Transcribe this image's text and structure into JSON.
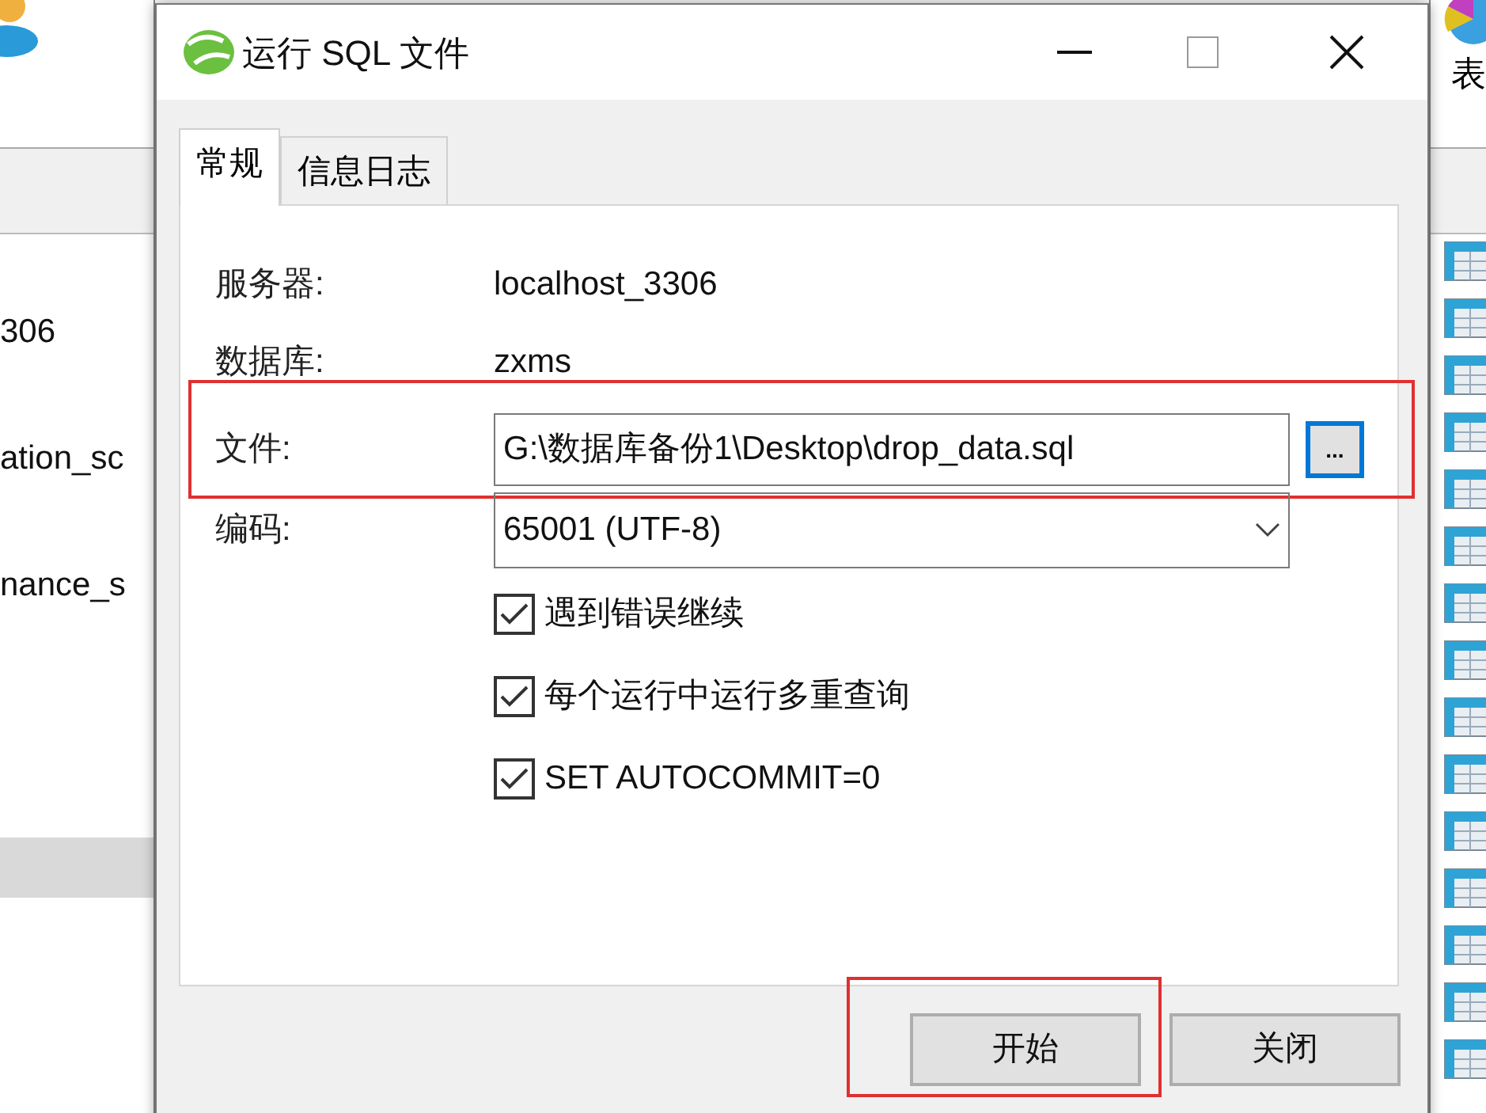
{
  "background": {
    "right_label": "表",
    "list_items": [
      {
        "label": "306",
        "selected": false
      },
      {
        "label": "ation_sc",
        "selected": false
      },
      {
        "label": "nance_s",
        "selected": false
      },
      {
        "selected": true
      }
    ]
  },
  "dialog": {
    "title": "运行 SQL 文件",
    "tabs": [
      {
        "label": "常规",
        "selected": true
      },
      {
        "label": "信息日志",
        "selected": false
      }
    ],
    "fields": [
      {
        "kind": "text",
        "label": "服务器:",
        "value": "localhost_3306"
      },
      {
        "kind": "text",
        "label": "数据库:",
        "value": "zxms"
      },
      {
        "kind": "file",
        "label": "文件:",
        "value": "G:\\数据库备份1\\Desktop\\drop_data.sql",
        "button": "...",
        "highlighted": true
      },
      {
        "kind": "select",
        "label": "编码:",
        "value": "65001 (UTF-8)"
      }
    ],
    "options": [
      {
        "label": "遇到错误继续",
        "checked": true
      },
      {
        "label": "每个运行中运行多重查询",
        "checked": true
      },
      {
        "label": "SET AUTOCOMMIT=0",
        "checked": true
      }
    ],
    "buttons": [
      {
        "label": "开始",
        "highlighted": true
      },
      {
        "label": "关闭",
        "highlighted": false
      }
    ]
  }
}
